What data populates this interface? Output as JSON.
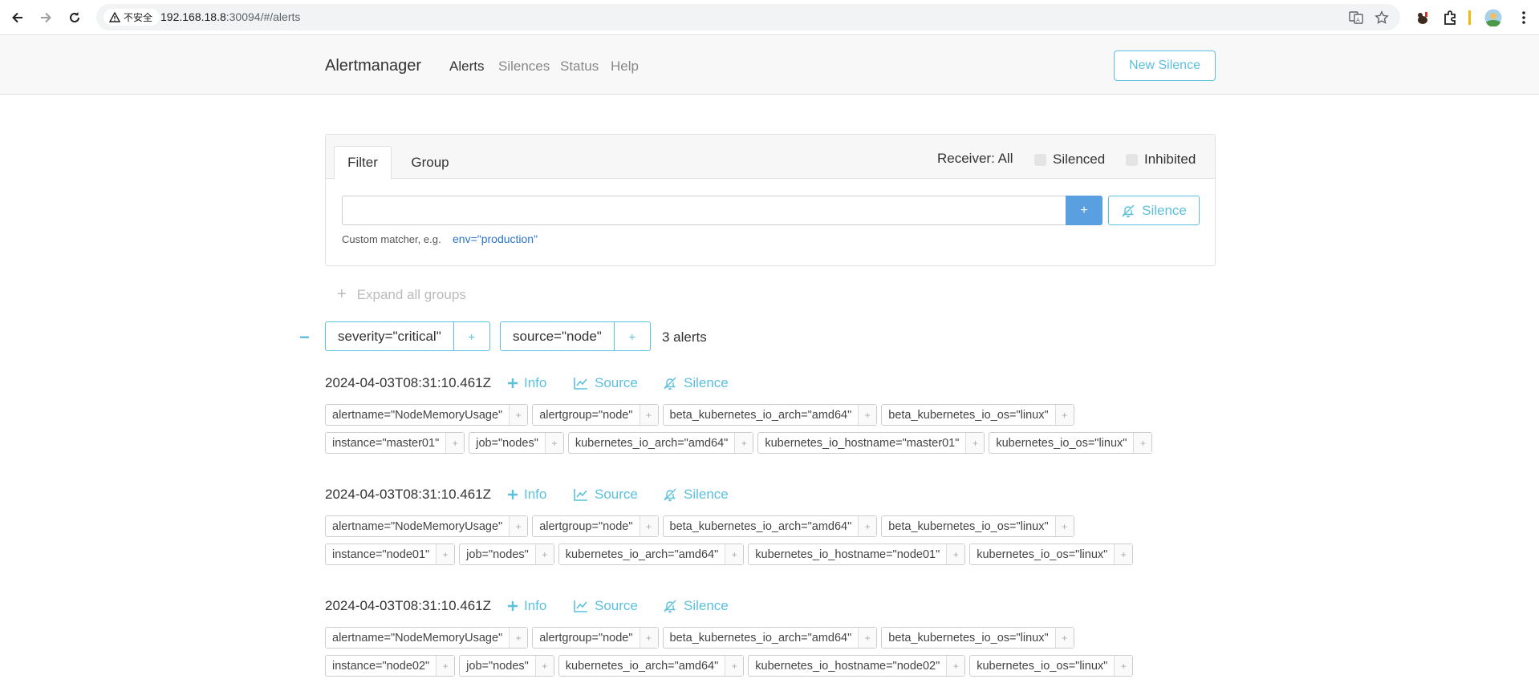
{
  "browser": {
    "security_label": "不安全",
    "url_host": "192.168.18.8",
    "url_rest": ":30094/#/alerts"
  },
  "navbar": {
    "brand": "Alertmanager",
    "links": [
      "Alerts",
      "Silences",
      "Status",
      "Help"
    ],
    "new_silence": "New Silence"
  },
  "filter": {
    "tabs": [
      "Filter",
      "Group"
    ],
    "receiver": "Receiver: All",
    "silenced": "Silenced",
    "inhibited": "Inhibited",
    "input_value": "",
    "plus": "+",
    "silence_button": "Silence",
    "hint": "Custom matcher, e.g.",
    "hint_example": "env=\"production\""
  },
  "expand_all": "Expand all groups",
  "group": {
    "collapse": "−",
    "labels": [
      "severity=\"critical\"",
      "source=\"node\""
    ],
    "plus": "+",
    "count": "3 alerts"
  },
  "alert_actions": {
    "info": "Info",
    "source": "Source",
    "silence": "Silence"
  },
  "alerts": [
    {
      "timestamp": "2024-04-03T08:31:10.461Z",
      "labels_row1": [
        "alertname=\"NodeMemoryUsage\"",
        "alertgroup=\"node\"",
        "beta_kubernetes_io_arch=\"amd64\"",
        "beta_kubernetes_io_os=\"linux\""
      ],
      "labels_row2": [
        "instance=\"master01\"",
        "job=\"nodes\"",
        "kubernetes_io_arch=\"amd64\"",
        "kubernetes_io_hostname=\"master01\"",
        "kubernetes_io_os=\"linux\""
      ]
    },
    {
      "timestamp": "2024-04-03T08:31:10.461Z",
      "labels_row1": [
        "alertname=\"NodeMemoryUsage\"",
        "alertgroup=\"node\"",
        "beta_kubernetes_io_arch=\"amd64\"",
        "beta_kubernetes_io_os=\"linux\""
      ],
      "labels_row2": [
        "instance=\"node01\"",
        "job=\"nodes\"",
        "kubernetes_io_arch=\"amd64\"",
        "kubernetes_io_hostname=\"node01\"",
        "kubernetes_io_os=\"linux\""
      ]
    },
    {
      "timestamp": "2024-04-03T08:31:10.461Z",
      "labels_row1": [
        "alertname=\"NodeMemoryUsage\"",
        "alertgroup=\"node\"",
        "beta_kubernetes_io_arch=\"amd64\"",
        "beta_kubernetes_io_os=\"linux\""
      ],
      "labels_row2": [
        "instance=\"node02\"",
        "job=\"nodes\"",
        "kubernetes_io_arch=\"amd64\"",
        "kubernetes_io_hostname=\"node02\"",
        "kubernetes_io_os=\"linux\""
      ]
    }
  ]
}
